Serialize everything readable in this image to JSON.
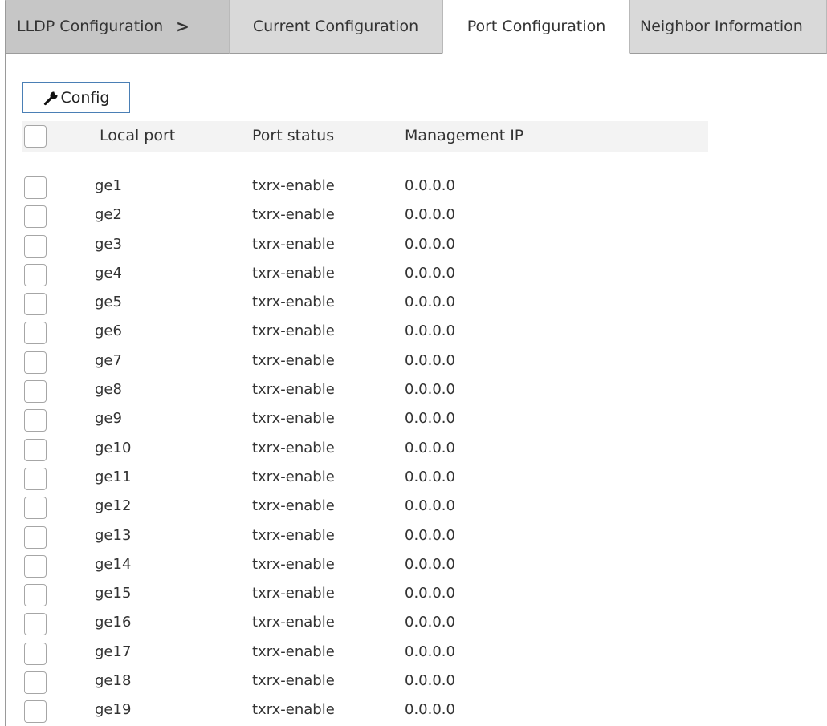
{
  "tabs": {
    "breadcrumb": "LLDP Configuration",
    "separator": ">",
    "items": [
      "Current Configuration",
      "Port Configuration",
      "Neighbor Information"
    ],
    "active": "Port Configuration"
  },
  "toolbar": {
    "config_label": "Config",
    "config_icon": "wrench-icon"
  },
  "table": {
    "headers": [
      "Local port",
      "Port status",
      "Management IP"
    ],
    "rows": [
      {
        "port": "ge1",
        "status": "txrx-enable",
        "ip": "0.0.0.0"
      },
      {
        "port": "ge2",
        "status": "txrx-enable",
        "ip": "0.0.0.0"
      },
      {
        "port": "ge3",
        "status": "txrx-enable",
        "ip": "0.0.0.0"
      },
      {
        "port": "ge4",
        "status": "txrx-enable",
        "ip": "0.0.0.0"
      },
      {
        "port": "ge5",
        "status": "txrx-enable",
        "ip": "0.0.0.0"
      },
      {
        "port": "ge6",
        "status": "txrx-enable",
        "ip": "0.0.0.0"
      },
      {
        "port": "ge7",
        "status": "txrx-enable",
        "ip": "0.0.0.0"
      },
      {
        "port": "ge8",
        "status": "txrx-enable",
        "ip": "0.0.0.0"
      },
      {
        "port": "ge9",
        "status": "txrx-enable",
        "ip": "0.0.0.0"
      },
      {
        "port": "ge10",
        "status": "txrx-enable",
        "ip": "0.0.0.0"
      },
      {
        "port": "ge11",
        "status": "txrx-enable",
        "ip": "0.0.0.0"
      },
      {
        "port": "ge12",
        "status": "txrx-enable",
        "ip": "0.0.0.0"
      },
      {
        "port": "ge13",
        "status": "txrx-enable",
        "ip": "0.0.0.0"
      },
      {
        "port": "ge14",
        "status": "txrx-enable",
        "ip": "0.0.0.0"
      },
      {
        "port": "ge15",
        "status": "txrx-enable",
        "ip": "0.0.0.0"
      },
      {
        "port": "ge16",
        "status": "txrx-enable",
        "ip": "0.0.0.0"
      },
      {
        "port": "ge17",
        "status": "txrx-enable",
        "ip": "0.0.0.0"
      },
      {
        "port": "ge18",
        "status": "txrx-enable",
        "ip": "0.0.0.0"
      },
      {
        "port": "ge19",
        "status": "txrx-enable",
        "ip": "0.0.0.0"
      }
    ]
  },
  "colors": {
    "header_bg": "#f3f3f3",
    "header_underline": "#6f95c5",
    "active_tab_bg": "#ffffff",
    "inactive_tab_bg": "#d9d9d9",
    "breadcrumb_bg": "#c6c6c6",
    "button_border": "#4a7fb5"
  }
}
